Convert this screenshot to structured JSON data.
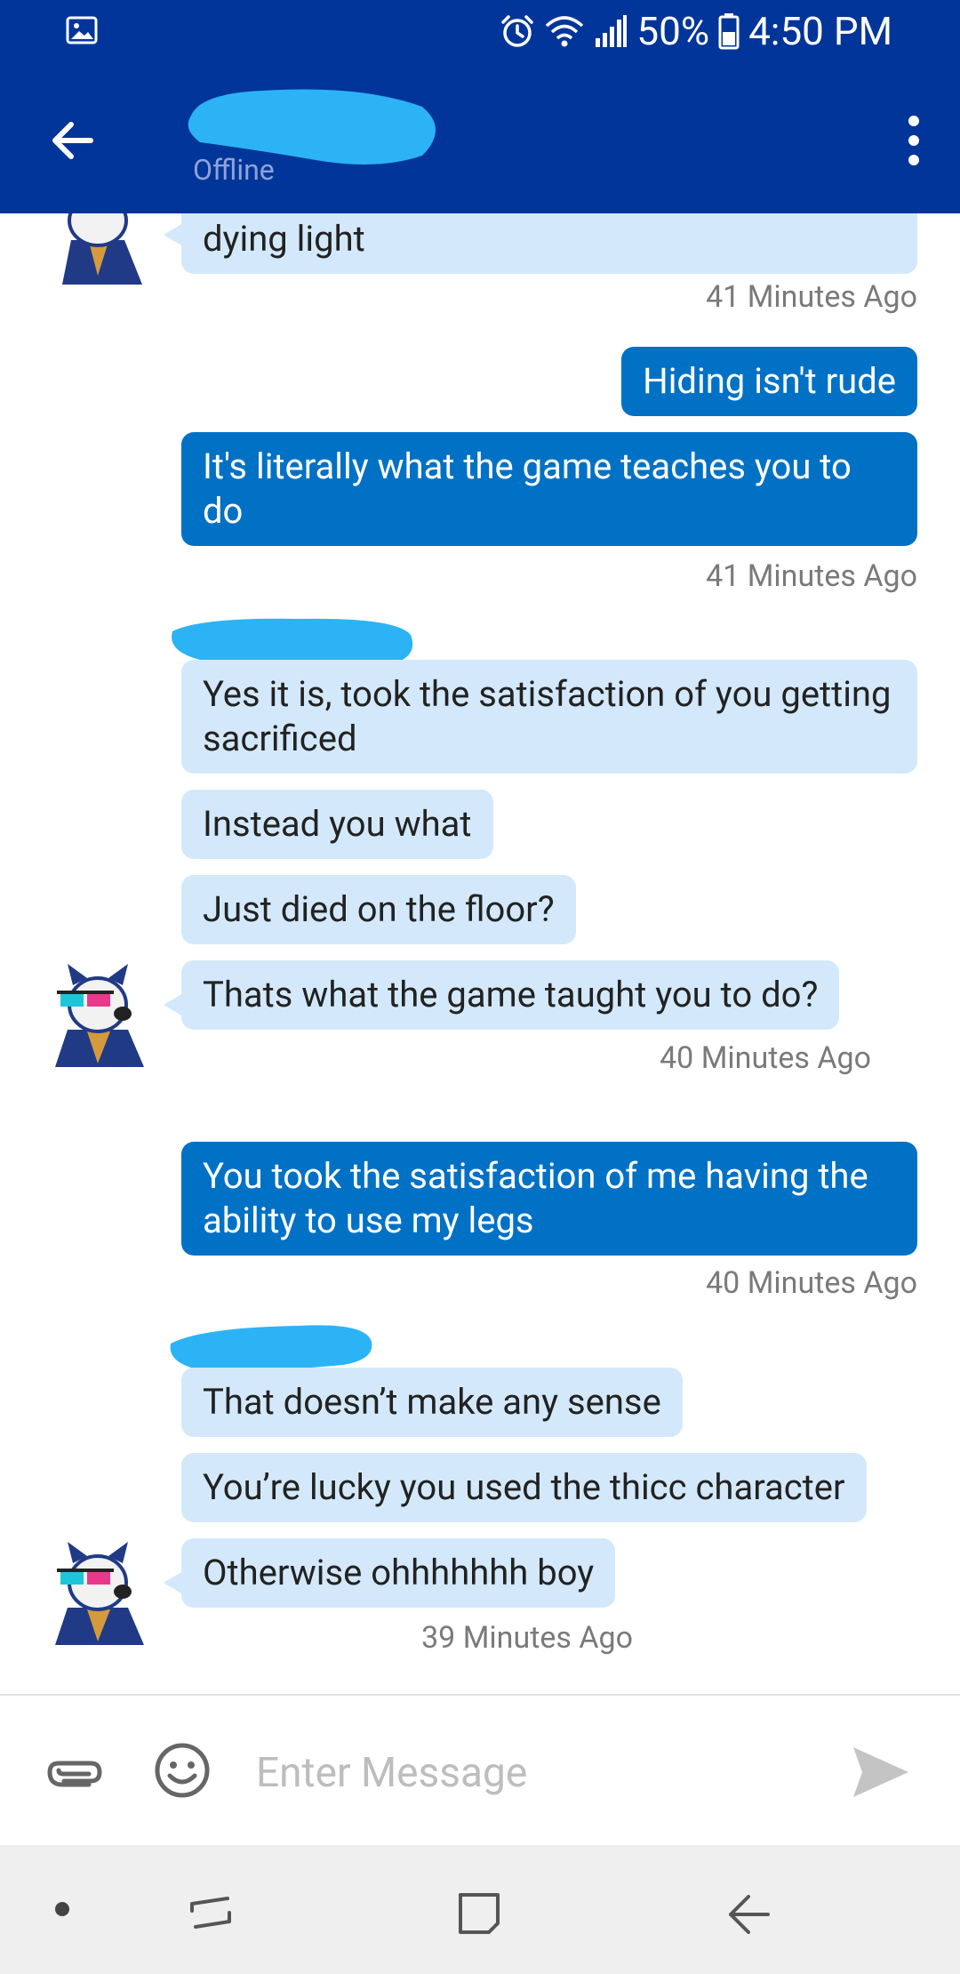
{
  "status_bar": {
    "battery": "50%",
    "time": "4:50 PM"
  },
  "header": {
    "status": "Offline"
  },
  "messages": {
    "m1": "dying light",
    "t1": "41 Minutes Ago",
    "m2": "Hiding isn't rude",
    "m3": "It's literally what the game teaches you to do",
    "t2": "41 Minutes Ago",
    "m4": "Yes it is, took the satisfaction of you getting sacrificed",
    "m5": "Instead you what",
    "m6": "Just died on the floor?",
    "m7": "Thats what the game taught you to do?",
    "t3": "40 Minutes Ago",
    "m8": "You took the satisfaction of me having the ability to use my legs",
    "t4": "40 Minutes Ago",
    "m9": "That doesn’t make any sense",
    "m10": "You’re lucky you used the thicc character",
    "m11": "Otherwise ohhhhhhh boy",
    "t5": "39 Minutes Ago"
  },
  "composer": {
    "placeholder": "Enter Message"
  },
  "colors": {
    "header": "#023599",
    "incoming_bubble": "#d3e9fb",
    "outgoing_bubble": "#0071c5",
    "redaction": "#2cb3f5"
  },
  "icons": [
    "image-icon",
    "alarm-icon",
    "wifi-icon",
    "signal-icon",
    "battery-icon",
    "back-arrow-icon",
    "more-vert-icon",
    "dog-avatar",
    "attach-icon",
    "emoji-icon",
    "send-icon",
    "recents-icon",
    "home-icon",
    "nav-back-icon"
  ]
}
